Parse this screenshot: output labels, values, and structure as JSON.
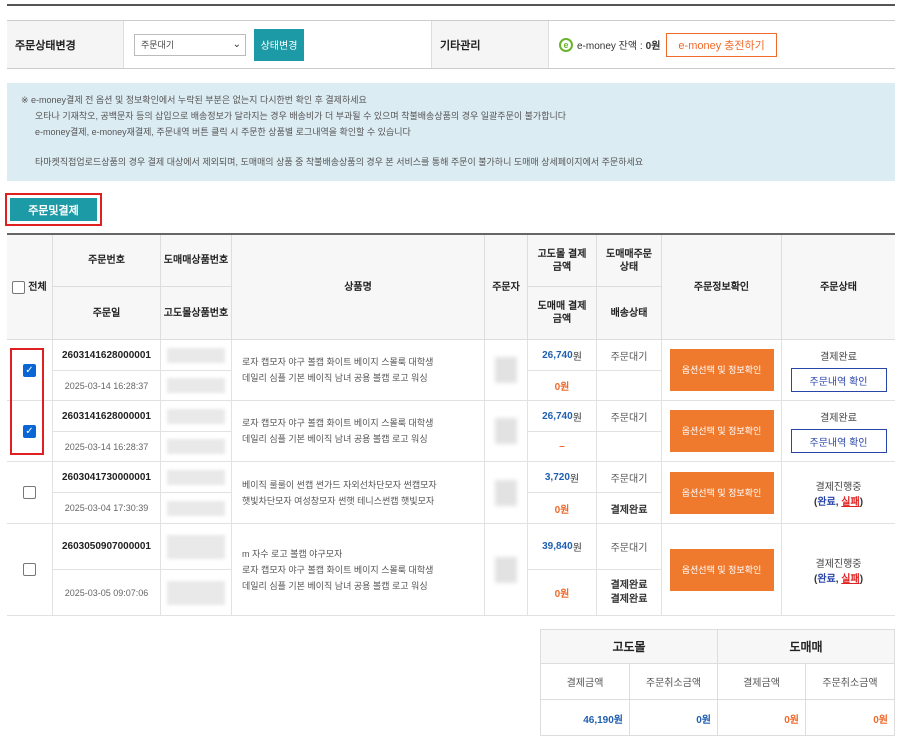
{
  "controls": {
    "status_change_label": "주문상태변경",
    "status_select_value": "주문대기",
    "status_change_button": "상태변경",
    "etc_label": "기타관리",
    "emoney_icon": "e",
    "emoney_balance_label": "e-money 잔액 :",
    "emoney_balance_value": "0원",
    "emoney_charge_button": "e-money 충전하기"
  },
  "notice": {
    "lines": [
      "※ e-money결제 전 옵션 및 정보확인에서 누락된 부분은 없는지 다시한번 확인 후 결제하세요",
      "오타나 기재착오, 공백문자 등의 삽입으로 배송정보가 달라지는 경우 배송비가 더 부과될 수 있으며 착불배송상품의 경우 일괄주문이 불가합니다",
      "e-money결제, e-money재결제, 주문내역 버튼 클릭 시 주문한 상품별 로그내역을 확인할 수 있습니다",
      "타마켓직접업로드상품의 경우 결제 대상에서 제외되며, 도매매의 상품 중 착불배송상품의 경우 본 서비스를 통해 주문이 불가하니 도매매 상세페이지에서 주문하세요"
    ]
  },
  "order_button": "주문및결제",
  "table": {
    "headers": {
      "select_all": "전체",
      "order_no": "주문번호",
      "wholesale_no": "도매매상품번호",
      "product_name": "상품명",
      "orderer": "주문자",
      "godo_amount": "고도몰 결제금액",
      "wholesale_status": "도매매주문상태",
      "order_info": "주문정보확인",
      "order_status": "주문상태",
      "order_date": "주문일",
      "godo_no": "고도몰상품번호",
      "wholesale_amount": "도매매 결제금액",
      "delivery_status": "배송상태"
    },
    "rows": [
      {
        "checked": true,
        "order_no": "2603141628000001",
        "order_date": "2025-03-14 16:28:37",
        "product_lines": [
          "로자 캡모자 야구 볼캡 화이트 베이지 스몰룩 대학생",
          "데일리 심플 기본 베이직 남녀 공용 볼캡 로고 워싱"
        ],
        "godo_amount": "26,740",
        "godo_unit": "원",
        "wholesale_amount": "0원",
        "wholesale_status": "주문대기",
        "delivery_status": "",
        "info_button": "옵션선택 및 정보확인",
        "status": "결제완료",
        "history_button": "주문내역 확인"
      },
      {
        "checked": true,
        "order_no": "2603141628000001",
        "order_date": "2025-03-14 16:28:37",
        "product_lines": [
          "로자 캡모자 야구 볼캡 화이트 베이지 스몰룩 대학생",
          "데일리 심플 기본 베이직 남녀 공용 볼캡 로고 워싱"
        ],
        "godo_amount": "26,740",
        "godo_unit": "원",
        "wholesale_amount": "–",
        "wholesale_status": "주문대기",
        "delivery_status": "",
        "info_button": "옵션선택 및 정보확인",
        "status": "결제완료",
        "history_button": "주문내역 확인"
      },
      {
        "checked": false,
        "order_no": "2603041730000001",
        "order_date": "2025-03-04 17:30:39",
        "product_lines": [
          "베이직 룰룰이 썬캡 썬가드 자외선차단모자 썬캡모자",
          "햇빛차단모자 여성창모자 썬햇 테니스썬캡 햇빛모자"
        ],
        "godo_amount": "3,720",
        "godo_unit": "원",
        "wholesale_amount": "0원",
        "wholesale_status": "주문대기",
        "delivery_status": "결제완료",
        "info_button": "옵션선택 및 정보확인",
        "status": "결제진행중",
        "status_done": "완료",
        "status_fail": "실패"
      },
      {
        "checked": false,
        "order_no": "2603050907000001",
        "order_date": "2025-03-05 09:07:06",
        "product_lines": [
          "m 자수 로고 볼캡 야구모자",
          "로자 캡모자 야구 볼캡 화이트 베이지 스몰룩 대학생",
          "데일리 심플 기본 베이직 남녀 공용 볼캡 로고 워싱"
        ],
        "godo_amount": "39,840",
        "godo_unit": "원",
        "wholesale_amount": "0원",
        "wholesale_status": "주문대기",
        "delivery_status": "결제완료",
        "delivery_status_2": "결제완료",
        "info_button": "옵션선택 및 정보확인",
        "status": "결제진행중",
        "status_done": "완료",
        "status_fail": "실패"
      }
    ]
  },
  "summary": {
    "godo_header": "고도몰",
    "wholesale_header": "도매매",
    "pay_label": "결제금액",
    "cancel_label": "주문취소금액",
    "godo_pay": "46,190원",
    "godo_cancel": "0원",
    "wholesale_pay": "0원",
    "wholesale_cancel": "0원"
  }
}
